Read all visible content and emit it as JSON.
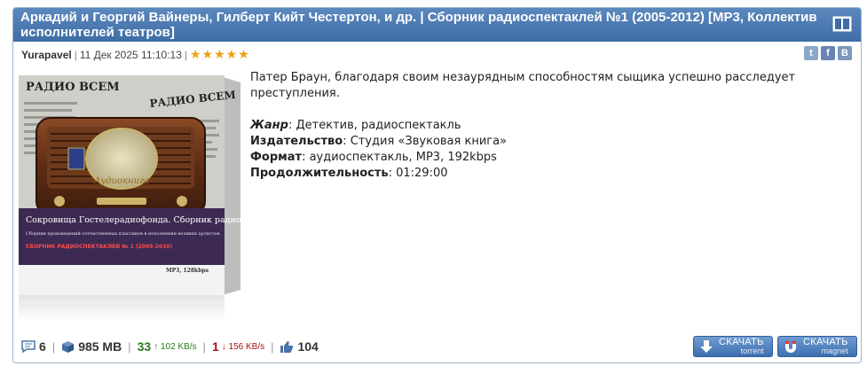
{
  "post": {
    "title": "Аркадий и Георгий Вайнеры, Гилберт Кийт Честертон, и др. | Сборник радиоспектаклей №1 (2005-2012) [MP3, Коллектив исполнителей театров]",
    "author": "Yurapavel",
    "date": "11 Дек 2025 11:10:13",
    "stars": "★★★★★",
    "description": "Патер Браун, благодаря своим незаурядным способностям сыщика успешно расследует преступления.",
    "fields": [
      {
        "key": "Жанр",
        "value": ": Детектив, радиоспектакль",
        "italic": true
      },
      {
        "key": "Издательство",
        "value": ": Студия «Звуковая книга»",
        "italic": false
      },
      {
        "key": "Формат",
        "value": ": аудиоспектакль, MP3, 192kbps",
        "italic": false
      },
      {
        "key": "Продолжительность",
        "value": ": 01:29:00",
        "italic": false
      }
    ]
  },
  "social": {
    "twitter": "t",
    "facebook": "f",
    "vk": "B"
  },
  "cover": {
    "newspaper_1": "РАДИО ВСЕМ",
    "newspaper_2": "РАДИО ВСЕМ",
    "brand": "Аудиокнига",
    "band_title": "Сокровища Гостелерадиофонда. Сборник радиоспектаклей",
    "band_sub": "Сборник произведений отечественных классиков в исполнении великих артистов.",
    "series": "СБОРНИК РАДИОСПЕКТАКЛЕЙ № 1 (2005-2010)",
    "format": "MP3, 128kbps"
  },
  "stats": {
    "comments": "6",
    "size": "985 MB",
    "seeders": "33",
    "seed_speed": "↑ 102 KB/s",
    "leechers": "1",
    "leech_speed": "↓ 156 KB/s",
    "likes": "104"
  },
  "buttons": {
    "torrent_label": "СКАЧАТЬ",
    "torrent_sub": "torrent",
    "magnet_label": "СКАЧАТЬ",
    "magnet_sub": "magnet"
  },
  "colors": {
    "accent": "#3f6da6",
    "seed": "#2a7a1d",
    "leech": "#aa1111",
    "star": "#f0a10a"
  }
}
